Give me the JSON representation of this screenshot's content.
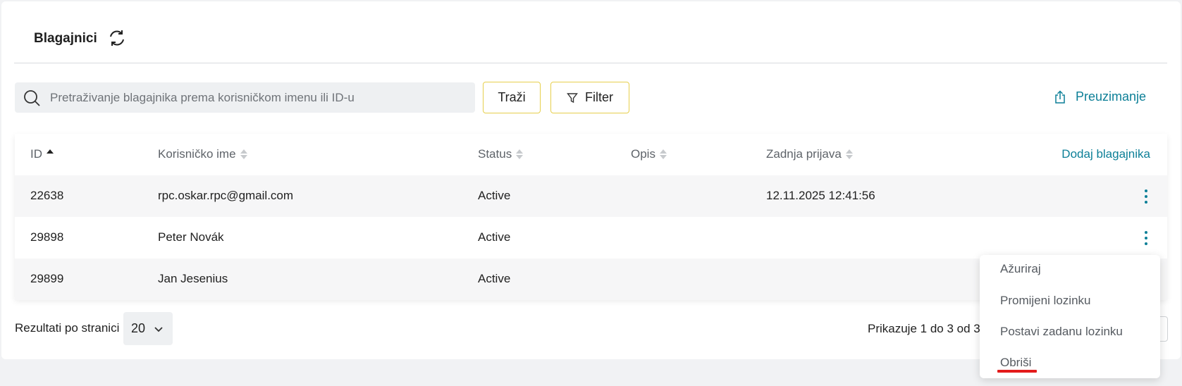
{
  "page": {
    "title": "Blagajnici"
  },
  "search": {
    "placeholder": "Pretraživanje blagajnika prema korisničkom imenu ili ID-u",
    "value": ""
  },
  "toolbar": {
    "search_label": "Traži",
    "filter_label": "Filter",
    "download_label": "Preuzimanje"
  },
  "table": {
    "columns": [
      "ID",
      "Korisničko ime",
      "Status",
      "Opis",
      "Zadnja prijava"
    ],
    "add_label": "Dodaj blagajnika",
    "rows": [
      {
        "id": "22638",
        "username": "rpc.oskar.rpc@gmail.com",
        "status": "Active",
        "description": "",
        "last_login": "12.11.2025 12:41:56"
      },
      {
        "id": "29898",
        "username": "Peter Novák",
        "status": "Active",
        "description": "",
        "last_login": ""
      },
      {
        "id": "29899",
        "username": "Jan Jesenius",
        "status": "Active",
        "description": "",
        "last_login": ""
      }
    ]
  },
  "pagination": {
    "per_page_label": "Rezultati po stranici",
    "per_page_value": "20",
    "showing_text": "Prikazuje 1 do 3 od 3"
  },
  "context_menu": {
    "items": [
      "Ažuriraj",
      "Promijeni lozinku",
      "Postavi zadanu lozinku",
      "Obriši"
    ],
    "highlight_color": "#e31b1b"
  },
  "colors": {
    "accent": "#0c7f97",
    "button_border": "#e6cf4c"
  },
  "icons": {
    "refresh": "refresh-icon",
    "search": "search-icon",
    "filter": "filter-icon",
    "download": "share-upload-icon",
    "more": "kebab-icon",
    "dropdown": "chevron-down-icon"
  }
}
